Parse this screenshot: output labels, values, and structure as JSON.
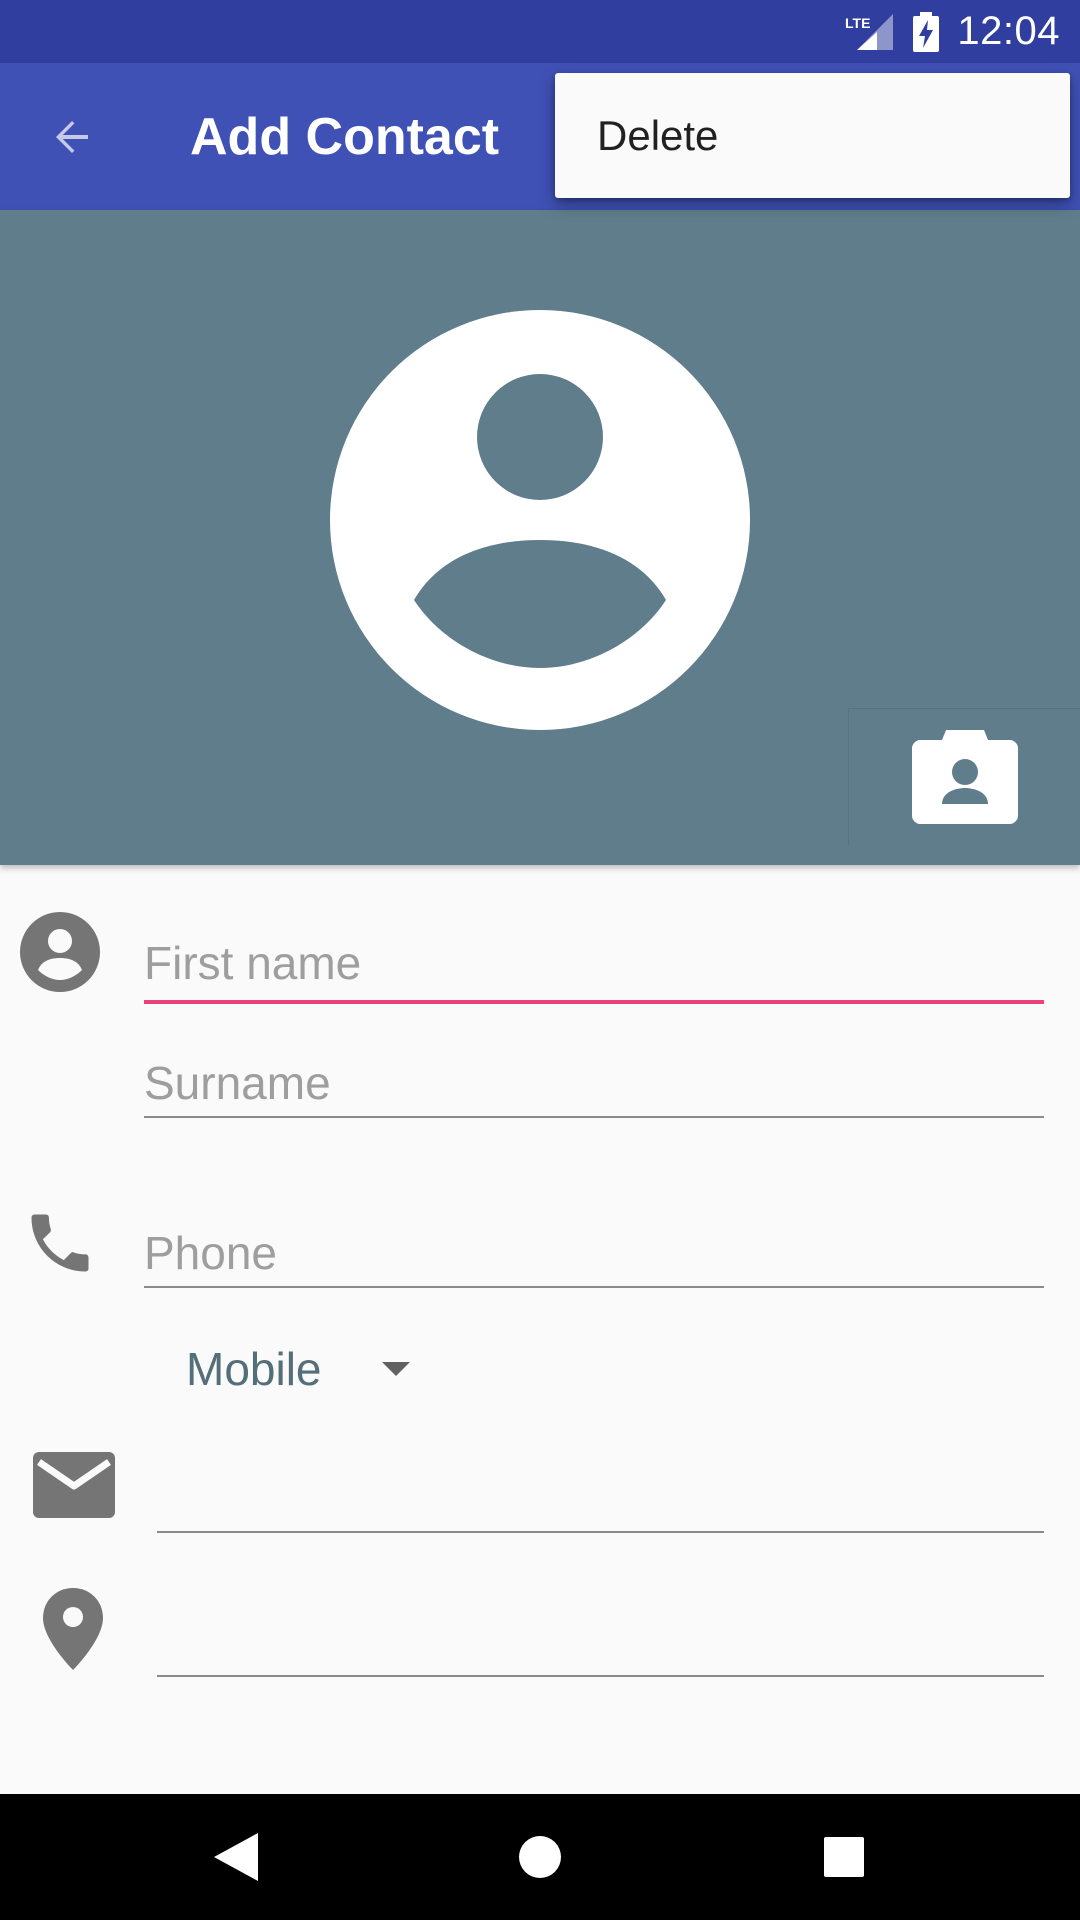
{
  "status_bar": {
    "time": "12:04",
    "network_label": "LTE",
    "icons": [
      "lte-signal-icon",
      "battery-charging-icon"
    ]
  },
  "app_bar": {
    "title": "Add Contact",
    "back_icon": "arrow-back-icon"
  },
  "overflow_menu": {
    "items": [
      {
        "label": "Delete"
      }
    ]
  },
  "photo": {
    "avatar_icon": "account-circle-icon",
    "camera_icon": "camera-contact-icon"
  },
  "form": {
    "first_name": {
      "placeholder": "First name",
      "value": ""
    },
    "surname": {
      "placeholder": "Surname",
      "value": ""
    },
    "phone": {
      "placeholder": "Phone",
      "value": ""
    },
    "phone_type": {
      "selected": "Mobile"
    },
    "email": {
      "value": ""
    },
    "address": {
      "value": ""
    }
  },
  "colors": {
    "primary": "#3f51b5",
    "primary_dark": "#303f9f",
    "accent": "#ec407a",
    "photo_bg": "#607d8b"
  }
}
